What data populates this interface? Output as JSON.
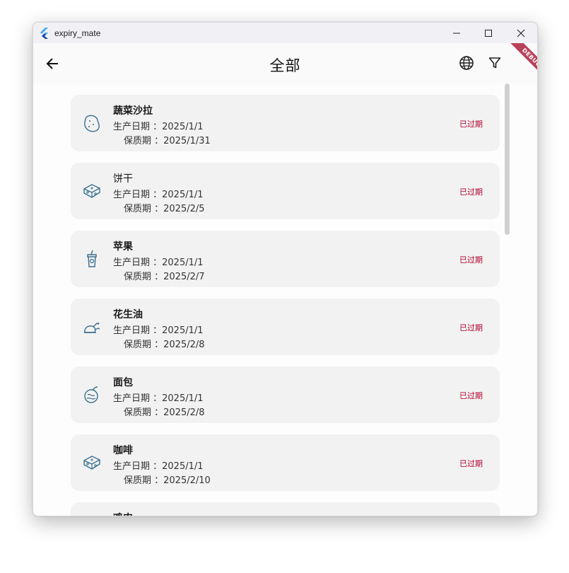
{
  "window": {
    "title": "expiry_mate"
  },
  "appbar": {
    "title": "全部",
    "debug_label": "DEBUG"
  },
  "labels": {
    "production_date": "生产日期 ：",
    "shelf_life": "保质期 ："
  },
  "items": [
    {
      "name": "蔬菜沙拉",
      "production": "2025/1/1",
      "expiry": "2025/1/31",
      "status": "已过期",
      "icon": "potato-icon"
    },
    {
      "name": "饼干",
      "production": "2025/1/1",
      "expiry": "2025/2/5",
      "status": "已过期",
      "icon": "cheese-icon"
    },
    {
      "name": "苹果",
      "production": "2025/1/1",
      "expiry": "2025/2/7",
      "status": "已过期",
      "icon": "drink-cup-icon"
    },
    {
      "name": "花生油",
      "production": "2025/1/1",
      "expiry": "2025/2/8",
      "status": "已过期",
      "icon": "roast-chicken-icon"
    },
    {
      "name": "面包",
      "production": "2025/1/1",
      "expiry": "2025/2/8",
      "status": "已过期",
      "icon": "fruit-icon"
    },
    {
      "name": "咖啡",
      "production": "2025/1/1",
      "expiry": "2025/2/10",
      "status": "已过期",
      "icon": "cheese-icon"
    },
    {
      "name": "鸡肉"
    }
  ],
  "colors": {
    "accent_icon": "#3a6f8c",
    "expired": "#b3002a",
    "card_bg": "#f2f2f3"
  }
}
